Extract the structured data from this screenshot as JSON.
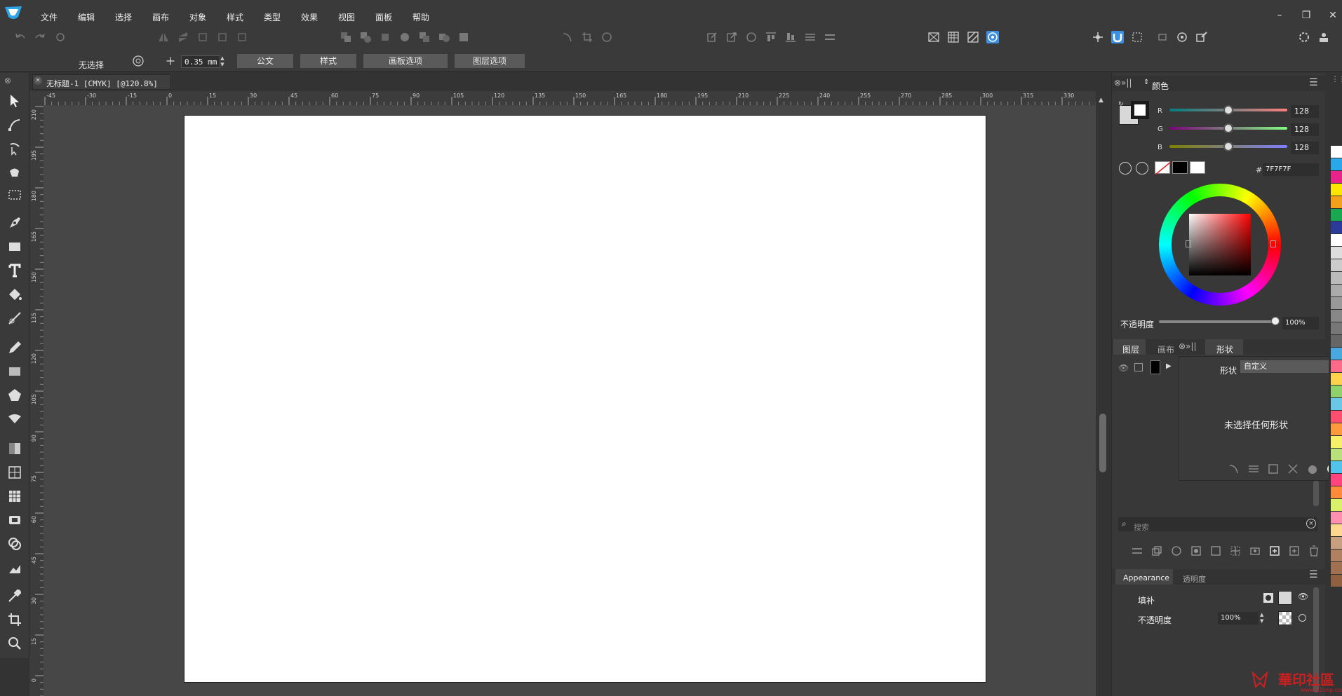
{
  "menu": {
    "items": [
      "文件",
      "编辑",
      "选择",
      "画布",
      "对象",
      "样式",
      "类型",
      "效果",
      "视图",
      "面板",
      "帮助"
    ]
  },
  "context_bar": {
    "selection_status": "无选择",
    "stroke_width": "0.35 mm",
    "buttons": [
      "公文",
      "样式",
      "画板选项",
      "图层选项"
    ]
  },
  "document": {
    "tab_title": "无标题-1 [CMYK] [@120.8%]"
  },
  "rulers": {
    "h_ticks": [
      "-45",
      "-30",
      "-15",
      "0",
      "15",
      "30",
      "45",
      "60",
      "75",
      "90",
      "105",
      "120",
      "135",
      "150",
      "165",
      "180",
      "195",
      "210",
      "225",
      "240",
      "255",
      "270",
      "285",
      "300",
      "315",
      "330"
    ],
    "v_ticks": [
      "210",
      "195",
      "180",
      "165",
      "150",
      "135",
      "120",
      "105",
      "90",
      "75",
      "60",
      "45",
      "30",
      "15",
      "0"
    ]
  },
  "color_panel": {
    "title": "颜色",
    "r_label": "R",
    "g_label": "G",
    "b_label": "B",
    "r": "128",
    "g": "128",
    "b": "128",
    "hex_label": "#",
    "hex": "7F7F7F",
    "opacity_label": "不透明度",
    "opacity": "100%"
  },
  "layers_panel": {
    "tabs": [
      "图层",
      "画布"
    ],
    "shape_tab": "形状",
    "shape_label": "形状",
    "shape_value": "自定义",
    "empty_message": "未选择任何形状",
    "search_placeholder": "搜索"
  },
  "appearance_panel": {
    "tabs": [
      "Appearance",
      "透明度"
    ],
    "fill_label": "填补",
    "opacity_label": "不透明度",
    "opacity_value": "100%"
  },
  "colors": {
    "accent": "#3d8fe0",
    "artboard": "#ffffff",
    "canvas_bg": "#474747"
  },
  "watermark": {
    "text": "華印社區",
    "url": "www.52cnp.com"
  }
}
